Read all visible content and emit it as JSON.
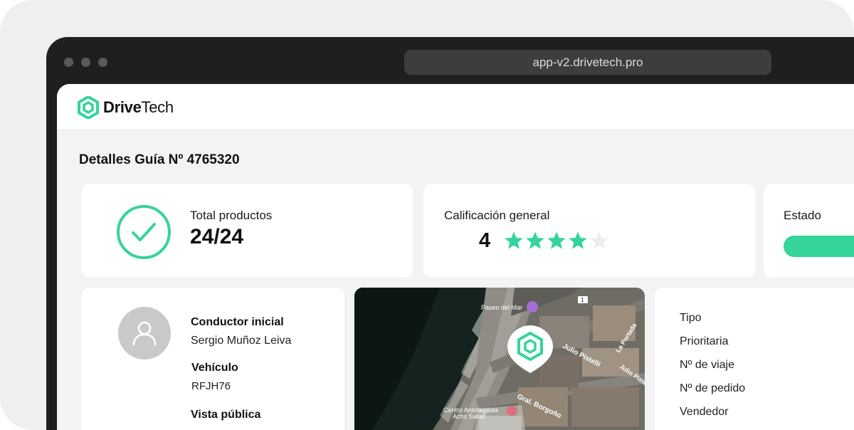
{
  "browser": {
    "url": "app-v2.drivetech.pro"
  },
  "app": {
    "logo_bold": "Drive",
    "logo_light": "Tech",
    "brand_color": "#35d49a"
  },
  "page": {
    "title": "Detalles Guía Nº 4765320"
  },
  "summary": {
    "products_label": "Total productos",
    "products_value": "24/24",
    "rating_label": "Calificación general",
    "rating_value": "4",
    "rating_stars_filled": 4,
    "rating_stars_total": 5,
    "status_label": "Estado"
  },
  "driver": {
    "initial_driver_label": "Conductor inicial",
    "initial_driver_value": "Sergio Muñoz Leiva",
    "vehicle_label": "Vehículo",
    "vehicle_value": "RFJH76",
    "public_view_label": "Vista pública"
  },
  "map": {
    "labels": [
      "Paseo del Mar",
      "Julio Pistelli",
      "La Portada",
      "Julio Pistelli",
      "Gral. Borgoño",
      "Centro Antofagasta",
      "Achs Salud",
      "1"
    ]
  },
  "details": {
    "labels": [
      "Tipo",
      "Prioritaria",
      "Nº de viaje",
      "Nº de pedido",
      "Vendedor"
    ]
  },
  "icons": {
    "check": "check-circle-icon",
    "star": "star-icon",
    "user": "user-icon",
    "map_pin": "map-pin-icon"
  }
}
